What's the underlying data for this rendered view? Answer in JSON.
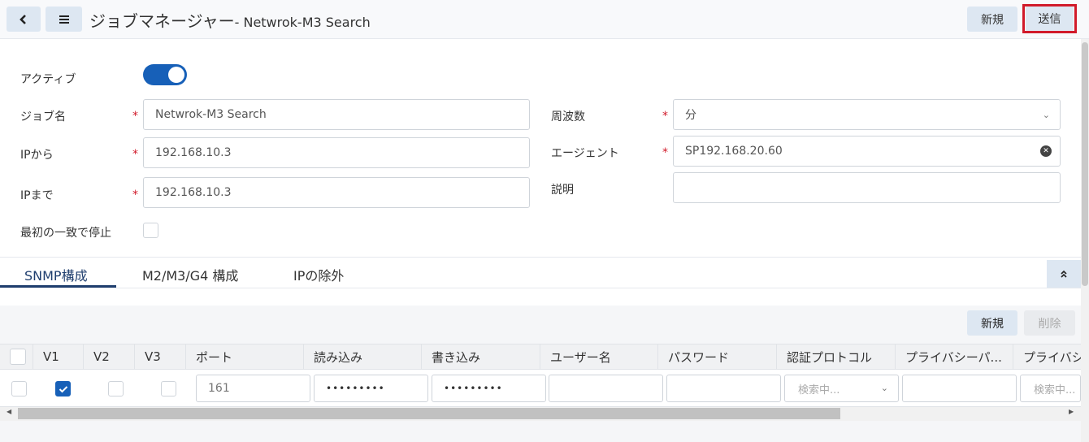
{
  "header": {
    "title": "ジョブマネージャー",
    "subtitle": " - Netwrok-M3 Search",
    "new_label": "新規",
    "send_label": "送信"
  },
  "form": {
    "active_label": "アクティブ",
    "active_on": true,
    "job_name_label": "ジョブ名",
    "job_name_value": "Netwrok-M3 Search",
    "ip_from_label": "IPから",
    "ip_from_value": "192.168.10.3",
    "ip_to_label": "IPまで",
    "ip_to_value": "192.168.10.3",
    "stop_first_label": "最初の一致で停止",
    "frequency_label": "周波数",
    "frequency_value": "分",
    "agent_label": "エージェント",
    "agent_value": "SP192.168.20.60",
    "description_label": "説明",
    "description_value": "",
    "required_mark": "*"
  },
  "tabs": [
    {
      "label": "SNMP構成",
      "active": true
    },
    {
      "label": "M2/M3/G4 構成",
      "active": false
    },
    {
      "label": "IPの除外",
      "active": false
    }
  ],
  "grid": {
    "new_label": "新規",
    "delete_label": "削除",
    "columns": [
      "V1",
      "V2",
      "V3",
      "ポート",
      "読み込み",
      "書き込み",
      "ユーザー名",
      "パスワード",
      "認証プロトコル",
      "プライバシーパ...",
      "プライバシ"
    ],
    "row": {
      "v1": true,
      "v2": false,
      "v3": false,
      "port": "161",
      "read": "•••••••••",
      "write": "•••••••••",
      "username": "",
      "password": "",
      "auth_placeholder": "検索中...",
      "privacy_pass": "",
      "privacy_placeholder": "検索中..."
    }
  },
  "colors": {
    "accent": "#1760b8",
    "required": "#d11a2a",
    "button_bg": "#dde7f2"
  }
}
